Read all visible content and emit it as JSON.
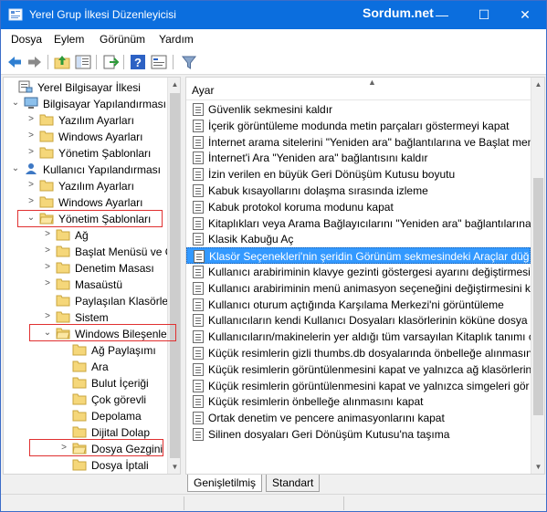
{
  "window": {
    "title": "Yerel Grup İlkesi Düzenleyicisi",
    "watermark": "Sordum.net",
    "controls": [
      "—",
      "☐",
      "✕"
    ]
  },
  "menu": [
    "Dosya",
    "Eylem",
    "Görünüm",
    "Yardım"
  ],
  "tree": [
    {
      "label": "Yerel Bilgisayar İlkesi",
      "expander": "",
      "icon": "computer-policy-icon"
    },
    {
      "label": "Bilgisayar Yapılandırması",
      "expander": "⌄",
      "icon": "computer-icon"
    },
    {
      "label": "Yazılım Ayarları",
      "expander": ">",
      "icon": "folder-icon"
    },
    {
      "label": "Windows Ayarları",
      "expander": ">",
      "icon": "folder-icon"
    },
    {
      "label": "Yönetim Şablonları",
      "expander": ">",
      "icon": "folder-icon"
    },
    {
      "label": "Kullanıcı Yapılandırması",
      "expander": "⌄",
      "icon": "user-icon"
    },
    {
      "label": "Yazılım Ayarları",
      "expander": ">",
      "icon": "folder-icon"
    },
    {
      "label": "Windows Ayarları",
      "expander": ">",
      "icon": "folder-icon"
    },
    {
      "label": "Yönetim Şablonları",
      "expander": "⌄",
      "icon": "folder-open-icon"
    },
    {
      "label": "Ağ",
      "expander": ">",
      "icon": "folder-icon"
    },
    {
      "label": "Başlat Menüsü ve G",
      "expander": ">",
      "icon": "folder-icon"
    },
    {
      "label": "Denetim Masası",
      "expander": ">",
      "icon": "folder-icon"
    },
    {
      "label": "Masaüstü",
      "expander": ">",
      "icon": "folder-icon"
    },
    {
      "label": "Paylaşılan Klasörle",
      "expander": "",
      "icon": "folder-icon"
    },
    {
      "label": "Sistem",
      "expander": ">",
      "icon": "folder-icon"
    },
    {
      "label": "Windows Bileşenle",
      "expander": "⌄",
      "icon": "folder-open-icon"
    },
    {
      "label": "Ağ Paylaşımı",
      "expander": "",
      "icon": "folder-icon"
    },
    {
      "label": "Ara",
      "expander": "",
      "icon": "folder-icon"
    },
    {
      "label": "Bulut İçeriği",
      "expander": "",
      "icon": "folder-icon"
    },
    {
      "label": "Çok görevli",
      "expander": "",
      "icon": "folder-icon"
    },
    {
      "label": "Depolama",
      "expander": "",
      "icon": "folder-icon"
    },
    {
      "label": "Dijital Dolap",
      "expander": "",
      "icon": "folder-icon"
    },
    {
      "label": "Dosya Gezgini",
      "expander": ">",
      "icon": "folder-open-icon"
    },
    {
      "label": "Dosya İptali",
      "expander": "",
      "icon": "folder-icon"
    }
  ],
  "settings": {
    "column_header": "Ayar",
    "rows": [
      "Güvenlik sekmesini kaldır",
      "İçerik görüntüleme modunda metin parçaları göstermeyi kapat",
      "İnternet arama sitelerini \"Yeniden ara\" bağlantılarına ve Başlat menü",
      "İnternet'i Ara \"Yeniden ara\" bağlantısını kaldır",
      "İzin verilen en büyük Geri Dönüşüm Kutusu boyutu",
      "Kabuk kısayollarını dolaşma sırasında izleme",
      "Kabuk protokol koruma modunu kapat",
      "Kitaplıkları veya Arama Bağlayıcılarını \"Yeniden ara\" bağlantılarına v",
      "Klasik Kabuğu Aç",
      "Klasör Seçenekleri'nin şeridin Görünüm sekmesindeki Araçlar düğm",
      "Kullanıcı arabiriminin klavye gezinti göstergesi ayarını değiştirmesin",
      "Kullanıcı arabiriminin menü animasyon seçeneğini değiştirmesini k",
      "Kullanıcı oturum açtığında Karşılama Merkezi'ni görüntüleme",
      "Kullanıcıların kendi Kullanıcı Dosyaları klasörlerinin köküne dosya e",
      "Kullanıcıların/makinelerin yer aldığı tüm varsayılan Kitaplık tanımı c",
      "Küçük resimlerin gizli thumbs.db dosyalarında önbelleğe alınmasın",
      "Küçük resimlerin görüntülenmesini kapat ve yalnızca ağ klasörlerin",
      "Küçük resimlerin görüntülenmesini kapat ve yalnızca simgeleri gör",
      "Küçük resimlerin önbelleğe alınmasını kapat",
      "Ortak denetim ve pencere animasyonlarını kapat",
      "Silinen dosyaları Geri Dönüşüm Kutusu'na taşıma"
    ],
    "selected_index": 9
  },
  "tabs": [
    "Genişletilmiş",
    "Standart"
  ],
  "colors": {
    "titlebar": "#0b6ede",
    "selection": "#3399ff",
    "annotation": "#e03030"
  }
}
